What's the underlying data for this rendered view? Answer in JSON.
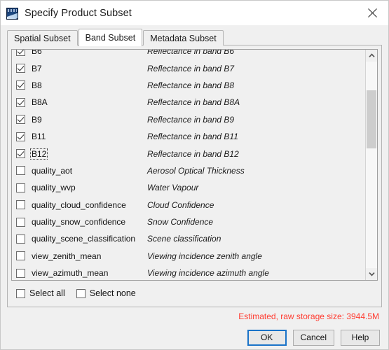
{
  "window": {
    "title": "Specify Product Subset",
    "icon": "snap-app-icon",
    "close_icon": "close-icon"
  },
  "tabs": [
    {
      "label": "Spatial Subset",
      "active": false
    },
    {
      "label": "Band Subset",
      "active": true
    },
    {
      "label": "Metadata Subset",
      "active": false
    }
  ],
  "band_list": {
    "rows": [
      {
        "name": "B6",
        "desc": "Reflectance in band B6",
        "checked": true,
        "focused": false
      },
      {
        "name": "B7",
        "desc": "Reflectance in band B7",
        "checked": true,
        "focused": false
      },
      {
        "name": "B8",
        "desc": "Reflectance in band B8",
        "checked": true,
        "focused": false
      },
      {
        "name": "B8A",
        "desc": "Reflectance in band B8A",
        "checked": true,
        "focused": false
      },
      {
        "name": "B9",
        "desc": "Reflectance in band B9",
        "checked": true,
        "focused": false
      },
      {
        "name": "B11",
        "desc": "Reflectance in band B11",
        "checked": true,
        "focused": false
      },
      {
        "name": "B12",
        "desc": "Reflectance in band B12",
        "checked": true,
        "focused": true
      },
      {
        "name": "quality_aot",
        "desc": "Aerosol Optical Thickness",
        "checked": false,
        "focused": false
      },
      {
        "name": "quality_wvp",
        "desc": "Water Vapour",
        "checked": false,
        "focused": false
      },
      {
        "name": "quality_cloud_confidence",
        "desc": "Cloud Confidence",
        "checked": false,
        "focused": false
      },
      {
        "name": "quality_snow_confidence",
        "desc": "Snow Confidence",
        "checked": false,
        "focused": false
      },
      {
        "name": "quality_scene_classification",
        "desc": "Scene classification",
        "checked": false,
        "focused": false
      },
      {
        "name": "view_zenith_mean",
        "desc": "Viewing incidence zenith angle",
        "checked": false,
        "focused": false
      },
      {
        "name": "view_azimuth_mean",
        "desc": "Viewing incidence azimuth angle",
        "checked": false,
        "focused": false
      }
    ],
    "scrollbar": {
      "up_icon": "chevron-up-icon",
      "down_icon": "chevron-down-icon",
      "thumb_top_pct": 14,
      "thumb_height_pct": 28
    }
  },
  "select_controls": [
    {
      "label": "Select all",
      "checked": false
    },
    {
      "label": "Select none",
      "checked": false
    }
  ],
  "status": {
    "text": "Estimated, raw storage size: 3944.5M",
    "color": "#ff3b30"
  },
  "buttons": [
    {
      "label": "OK",
      "default": true
    },
    {
      "label": "Cancel",
      "default": false
    },
    {
      "label": "Help",
      "default": false
    }
  ]
}
